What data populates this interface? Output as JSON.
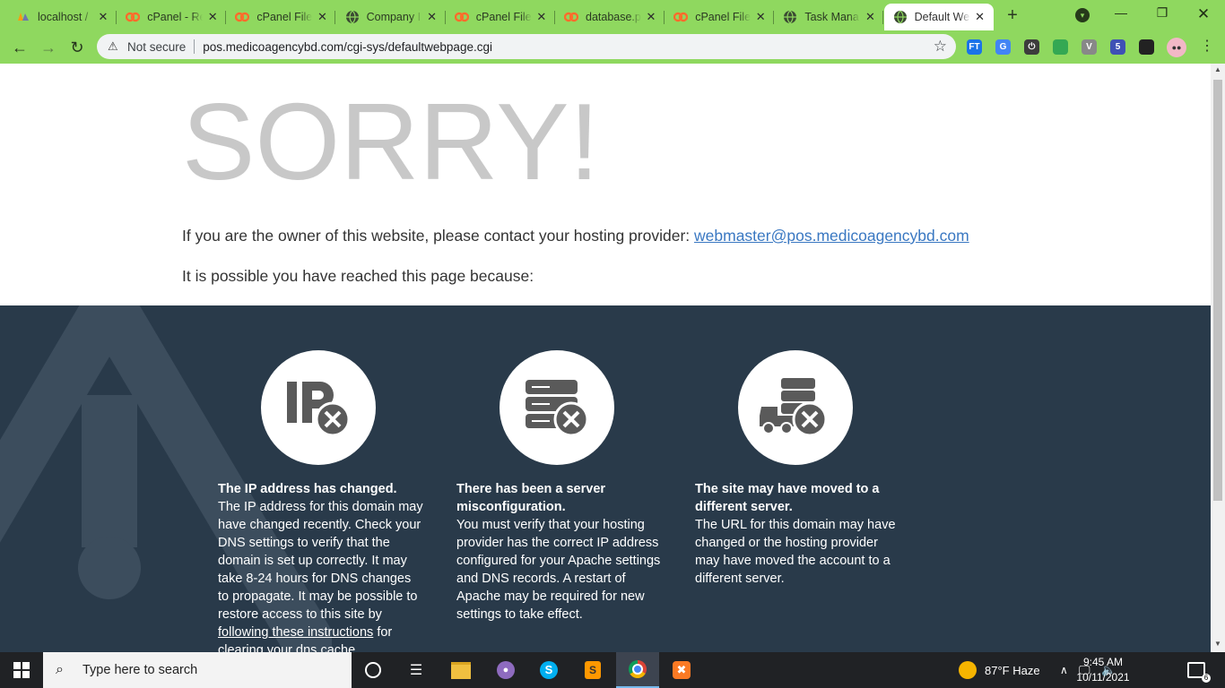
{
  "browser": {
    "tabs": [
      {
        "title": "localhost /",
        "icon": "phpmyadmin-icon"
      },
      {
        "title": "cPanel - Re",
        "icon": "cpanel-icon"
      },
      {
        "title": "cPanel File",
        "icon": "cpanel-icon"
      },
      {
        "title": "Company I",
        "icon": "globe-icon"
      },
      {
        "title": "cPanel File",
        "icon": "cpanel-icon"
      },
      {
        "title": "database.p",
        "icon": "cpanel-icon"
      },
      {
        "title": "cPanel File",
        "icon": "cpanel-icon"
      },
      {
        "title": "Task Mana",
        "icon": "globe-icon"
      },
      {
        "title": "Default We",
        "icon": "globe-icon",
        "active": true
      }
    ],
    "security_label": "Not secure",
    "url": "pos.medicoagencybd.com/cgi-sys/defaultwebpage.cgi",
    "extensions": [
      {
        "name": "ft-extension-icon",
        "label": "FT",
        "color": "#1a73e8"
      },
      {
        "name": "translate-extension-icon",
        "label": "G",
        "color": "#4285f4"
      },
      {
        "name": "toggl-extension-icon",
        "label": "⏻",
        "color": "#3c3c3c"
      },
      {
        "name": "green-extension-icon",
        "label": "",
        "color": "#34a853"
      },
      {
        "name": "vue-extension-icon",
        "label": "V",
        "color": "#888888"
      },
      {
        "name": "badge-extension-icon",
        "label": "5",
        "color": "#3f51b5"
      },
      {
        "name": "puzzle-extensions-icon",
        "label": "",
        "color": "#222222"
      }
    ]
  },
  "page": {
    "heading": "SORRY!",
    "owner_text": "If you are the owner of this website, please contact your hosting provider: ",
    "owner_email": "webmaster@pos.medicoagencybd.com",
    "reasons_intro": "It is possible you have reached this page because:",
    "reasons": [
      {
        "title": "The IP address has changed.",
        "text": "The IP address for this domain may have changed recently. Check your DNS settings to verify that the domain is set up correctly. It may take 8-24 hours for DNS changes to propagate. It may be possible to restore access to this site by ",
        "link": "following these instructions",
        "text_after": " for clearing your dns cache."
      },
      {
        "title": "There has been a server misconfiguration.",
        "text": "You must verify that your hosting provider has the correct IP address configured for your Apache settings and DNS records. A restart of Apache may be required for new settings to take effect."
      },
      {
        "title": "The site may have moved to a different server.",
        "text": "The URL for this domain may have changed or the hosting provider may have moved the account to a different server."
      }
    ]
  },
  "taskbar": {
    "search_placeholder": "Type here to search",
    "weather": "87°F  Haze",
    "time": "9:45 AM",
    "date": "10/11/2021",
    "notifications": "6"
  }
}
